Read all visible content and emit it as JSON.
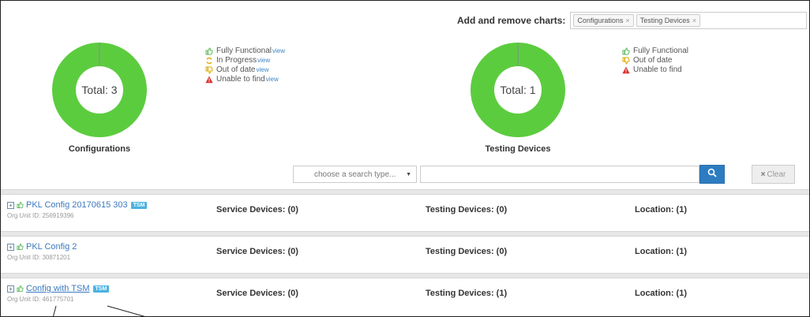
{
  "charts_selector": {
    "label": "Add and remove charts:",
    "tags": [
      {
        "label": "Configurations"
      },
      {
        "label": "Testing Devices"
      }
    ],
    "remove_symbol": "×"
  },
  "charts": [
    {
      "name": "Configurations",
      "total_label": "Total: 3",
      "color": "#5ccc3f",
      "legend": [
        {
          "label": "Fully Functional",
          "link": "view",
          "icon": "thumbs-up-icon"
        },
        {
          "label": "In Progress",
          "link": "view",
          "icon": "in-progress-icon"
        },
        {
          "label": "Out of date",
          "link": "view",
          "icon": "thumbs-down-icon"
        },
        {
          "label": "Unable to find",
          "link": "view",
          "icon": "warning-icon"
        }
      ]
    },
    {
      "name": "Testing Devices",
      "total_label": "Total: 1",
      "color": "#5ccc3f",
      "legend": [
        {
          "label": "Fully Functional",
          "icon": "thumbs-up-icon"
        },
        {
          "label": "Out of date",
          "icon": "thumbs-down-icon"
        },
        {
          "label": "Unable to find",
          "icon": "warning-icon"
        }
      ]
    }
  ],
  "search": {
    "type_placeholder": "choose a search type...",
    "input_value": "",
    "clear_label": "Clear",
    "clear_symbol": "×"
  },
  "rows": [
    {
      "name": "PKL Config 20170615 303",
      "tsm": "TSM",
      "org_unit": "Org Unit ID: 256919396",
      "service_devices": "Service Devices: (0)",
      "testing_devices": "Testing Devices: (0)",
      "location": "Location: (1)"
    },
    {
      "name": "PKL Config 2",
      "tsm": "",
      "org_unit": "Org Unit ID: 30871201",
      "service_devices": "Service Devices: (0)",
      "testing_devices": "Testing Devices: (0)",
      "location": "Location: (1)"
    },
    {
      "name": "Config with TSM",
      "tsm": "TSM",
      "org_unit": "Org Unit ID: 461775701",
      "service_devices": "Service Devices: (0)",
      "testing_devices": "Testing Devices: (1)",
      "location": "Location: (1)"
    }
  ],
  "expand_symbol": "+",
  "colors": {
    "accent": "#2d7cc1",
    "link": "#3a7abf",
    "success": "#5cb85c",
    "warning": "#e0a800",
    "danger": "#d9302c",
    "tsm_badge": "#4bb3e0"
  }
}
